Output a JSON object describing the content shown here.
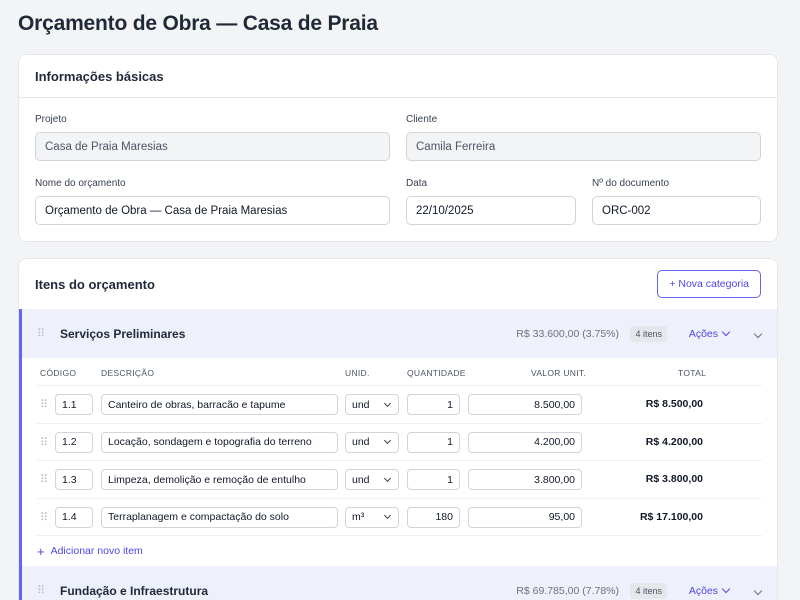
{
  "page": {
    "title": "Orçamento de Obra — Casa de Praia"
  },
  "basic_info": {
    "title": "Informações básicas",
    "project_label": "Projeto",
    "project_value": "Casa de Praia Maresias",
    "client_label": "Cliente",
    "client_value": "Camila Ferreira",
    "budget_name_label": "Nome do orçamento",
    "budget_name_value": "Orçamento de Obra — Casa de Praia Maresias",
    "date_label": "Data",
    "date_value": "22/10/2025",
    "doc_number_label": "Nº do documento",
    "doc_number_value": "ORC-002"
  },
  "items_section": {
    "title": "Itens do orçamento",
    "new_category_label": "+ Nova categoria",
    "columns": {
      "code": "CÓDIGO",
      "description": "DESCRIÇÃO",
      "unit": "UNID.",
      "quantity": "QUANTIDADE",
      "unit_value": "VALOR UNIT.",
      "total": "TOTAL"
    },
    "categories": [
      {
        "name": "Serviços Preliminares",
        "total": "R$ 33.600,00 (3.75%)",
        "badge": "4 itens",
        "actions_label": "Ações",
        "add_item_label": "Adicionar novo item",
        "items": [
          {
            "code": "1.1",
            "description": "Canteiro de obras, barracão e tapume",
            "unit": "und",
            "quantity": "1",
            "unit_value": "8.500,00",
            "total": "R$ 8.500,00"
          },
          {
            "code": "1.2",
            "description": "Locação, sondagem e topografia do terreno",
            "unit": "und",
            "quantity": "1",
            "unit_value": "4.200,00",
            "total": "R$ 4.200,00"
          },
          {
            "code": "1.3",
            "description": "Limpeza, demolição e remoção de entulho",
            "unit": "und",
            "quantity": "1",
            "unit_value": "3.800,00",
            "total": "R$ 3.800,00"
          },
          {
            "code": "1.4",
            "description": "Terraplanagem e compactação do solo",
            "unit": "m³",
            "quantity": "180",
            "unit_value": "95,00",
            "total": "R$ 17.100,00"
          }
        ]
      },
      {
        "name": "Fundação e Infraestrutura",
        "total": "R$ 69.785,00 (7.78%)",
        "badge": "4 itens",
        "actions_label": "Ações"
      }
    ]
  },
  "icons": {
    "drag": "drag-handle-icon",
    "chevron": "chevron-down-icon",
    "plus": "plus-icon"
  },
  "colors": {
    "accent": "#4f46e5",
    "category_bg": "#eef0fb",
    "page_bg": "#f3f4f6"
  }
}
